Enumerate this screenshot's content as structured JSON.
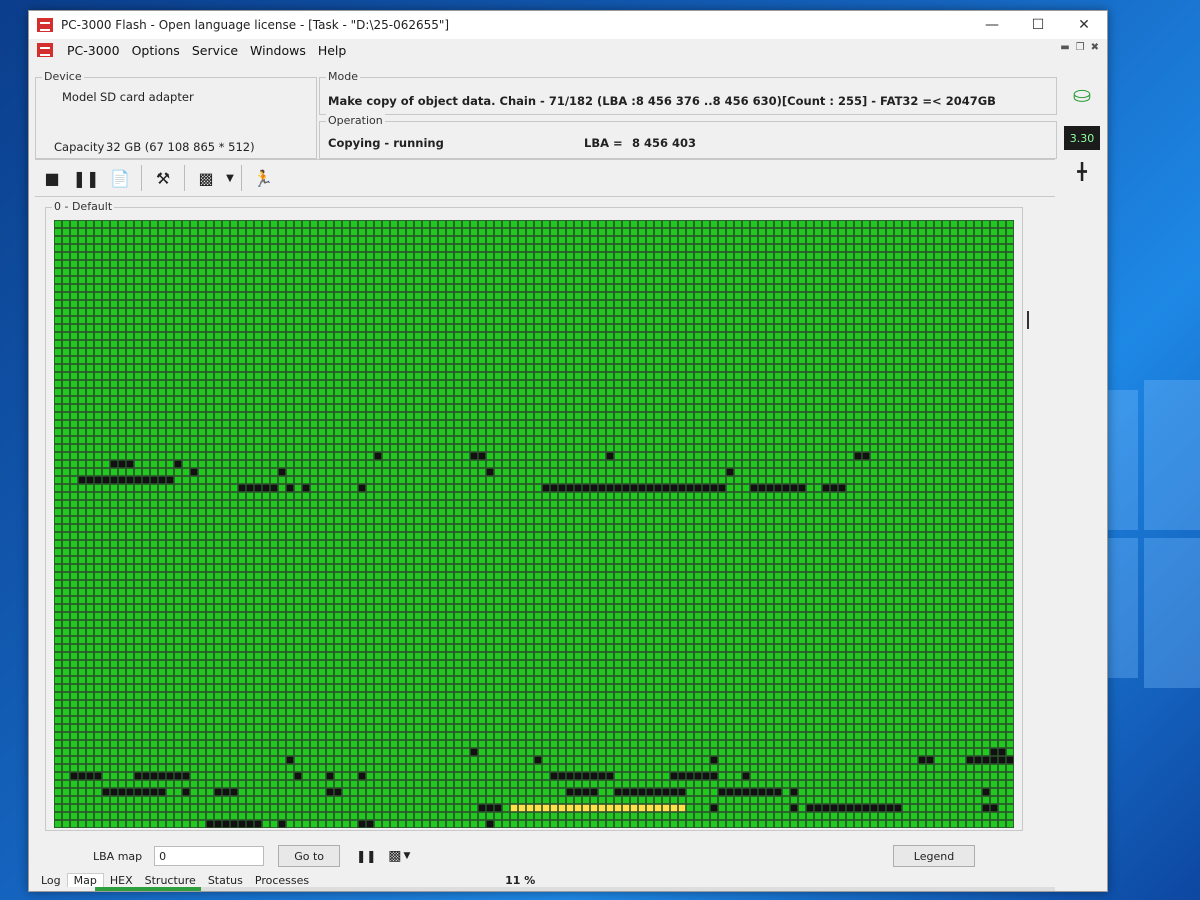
{
  "window": {
    "title": "PC-3000 Flash - Open language license - [Task - \"D:\\25-062655\"]"
  },
  "menu": {
    "items": [
      "PC-3000",
      "Options",
      "Service",
      "Windows",
      "Help"
    ]
  },
  "device": {
    "group_title": "Device",
    "model_label": "Model",
    "model_value": "SD card adapter",
    "capacity_label": "Capacity",
    "capacity_value": "32 GB (67 108 865 * 512)"
  },
  "mode": {
    "group_title": "Mode",
    "text": "Make copy of object data. Chain - 71/182 (LBA :8 456 376 ..8 456 630)[Count :    255] - FAT32 =< 2047GB"
  },
  "operation": {
    "group_title": "Operation",
    "status": "Copying - running",
    "lba_label": "LBA =",
    "lba_value": "8 456 403"
  },
  "side": {
    "version": "3.30"
  },
  "map": {
    "group_title": "0 - Default",
    "colors": {
      "ok": "#22c722",
      "bad": "#111111",
      "current": "#ffe14a",
      "border": "#1d4d1d"
    }
  },
  "bottom": {
    "lba_map_label": "LBA map",
    "lba_map_value": "0",
    "goto_label": "Go to",
    "legend_label": "Legend",
    "percent": "11 %",
    "progress_fraction": 0.11
  },
  "tabs": [
    "Log",
    "Map",
    "HEX",
    "Structure",
    "Status",
    "Processes"
  ]
}
